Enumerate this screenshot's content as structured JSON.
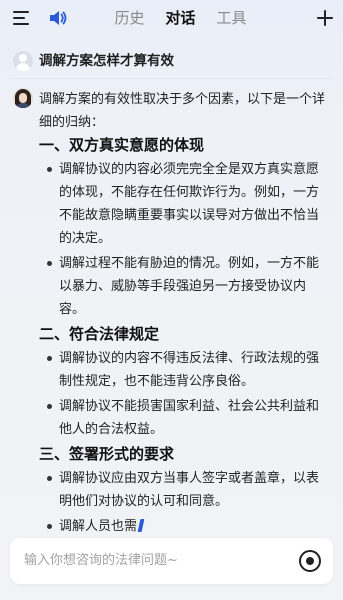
{
  "header": {
    "tabs": [
      {
        "label": "历史",
        "active": false
      },
      {
        "label": "对话",
        "active": true
      },
      {
        "label": "工具",
        "active": false
      }
    ],
    "icons": [
      "menu-icon",
      "speaker-icon",
      "plus-icon"
    ]
  },
  "question": {
    "text": "调解方案怎样才算有效"
  },
  "answer": {
    "intro": "调解方案的有效性取决于多个因素，以下是一个详细的归纳：",
    "sections": [
      {
        "heading": "一、双方真实意愿的体现",
        "bullets": [
          "调解协议的内容必须完完全全是双方真实意愿的体现，不能存在任何欺诈行为。例如，一方不能故意隐瞒重要事实以误导对方做出不恰当的决定。",
          "调解过程不能有胁迫的情况。例如，一方不能以暴力、威胁等手段强迫另一方接受协议内容。"
        ]
      },
      {
        "heading": "二、符合法律规定",
        "bullets": [
          "调解协议的内容不得违反法律、行政法规的强制性规定，也不能违背公序良俗。",
          "调解协议不能损害国家利益、社会公共利益和他人的合法权益。"
        ]
      },
      {
        "heading": "三、签署形式的要求",
        "bullets": [
          "调解协议应由双方当事人签字或者盖章，以表明他们对协议的认可和同意。",
          "调解人员也需"
        ]
      }
    ]
  },
  "input": {
    "placeholder": "输入你想咨询的法律问题~"
  },
  "colors": {
    "accent": "#2a5bd7",
    "text": "#222222",
    "muted": "#8a8a8a"
  }
}
